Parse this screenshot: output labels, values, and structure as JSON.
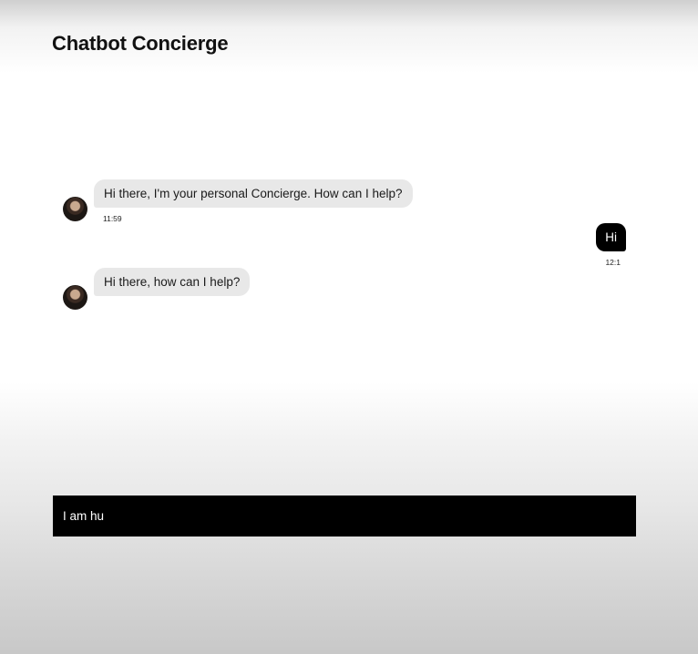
{
  "header": {
    "title": "Chatbot Concierge"
  },
  "messages": [
    {
      "sender": "bot",
      "avatar_icon": "bot-avatar-icon",
      "text": "Hi there, I'm your personal Concierge. How can I help?",
      "time": "11:59"
    },
    {
      "sender": "user",
      "text": "Hi",
      "time": "12:1"
    },
    {
      "sender": "bot",
      "avatar_icon": "bot-avatar-icon",
      "text": "Hi there, how can I help?",
      "time": ""
    }
  ],
  "composer": {
    "value": "I am hu",
    "placeholder": ""
  },
  "colors": {
    "bot_bubble": "#e8e8e8",
    "user_bubble": "#000000",
    "composer_bg": "#000000",
    "composer_text": "#ffffff"
  }
}
